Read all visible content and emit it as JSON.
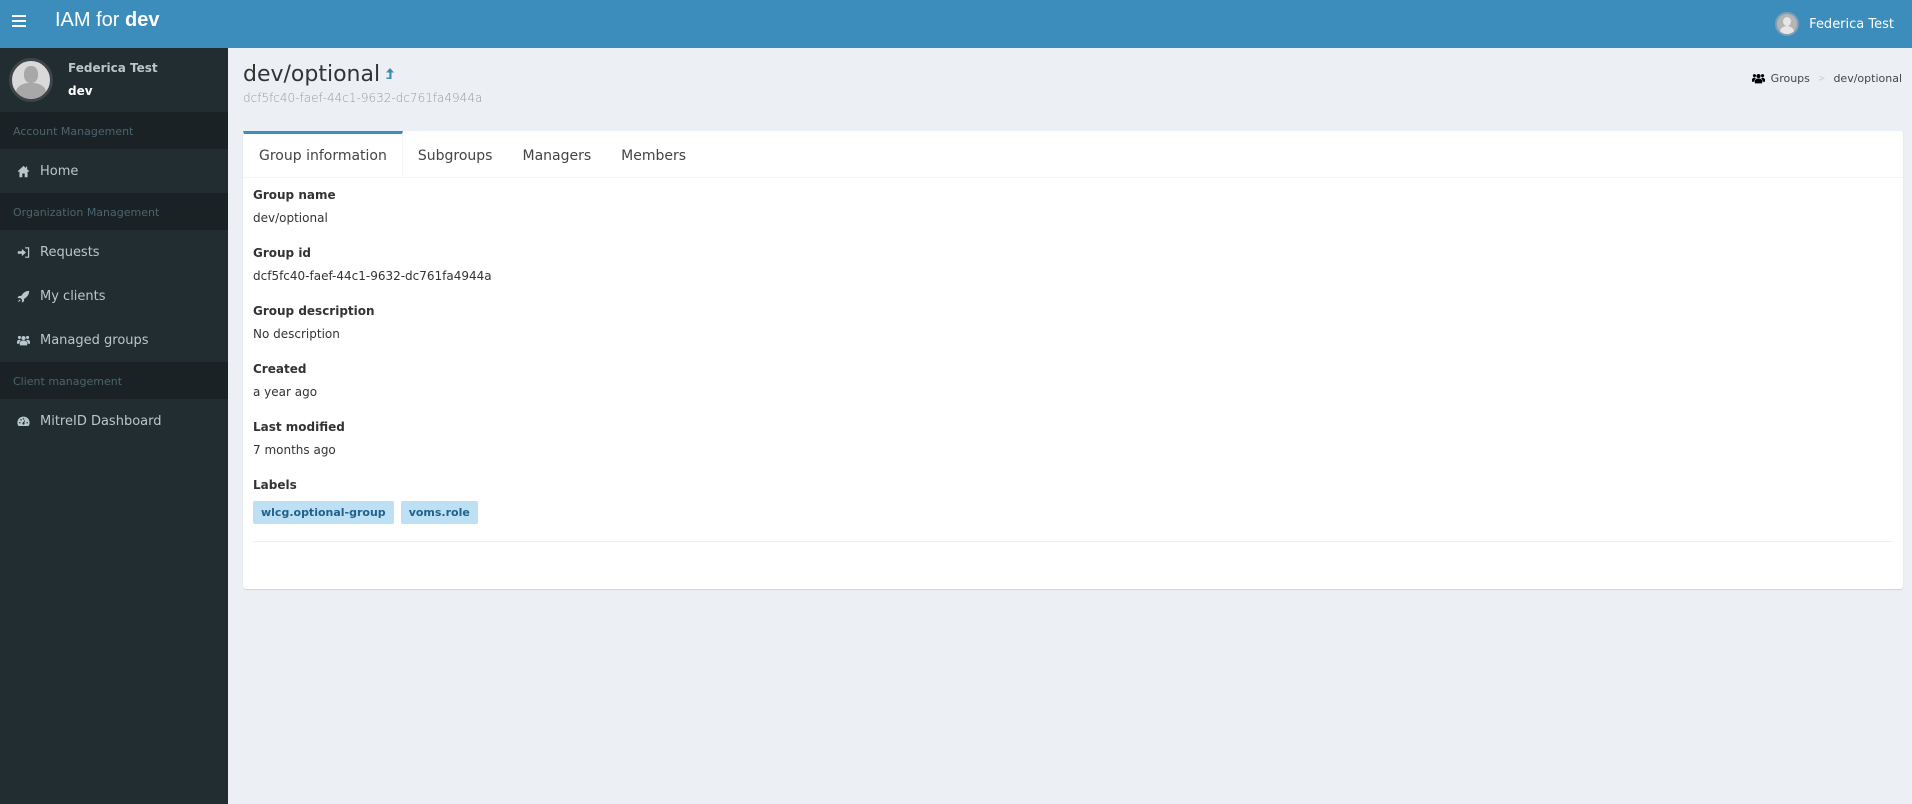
{
  "header": {
    "brand_prefix": "IAM for ",
    "brand_org": "dev",
    "user_name": "Federica Test"
  },
  "sidebar": {
    "user_name": "Federica Test",
    "user_org": "dev",
    "sections": [
      {
        "header": "Account Management",
        "items": [
          {
            "label": "Home",
            "icon": "home-icon"
          }
        ]
      },
      {
        "header": "Organization Management",
        "items": [
          {
            "label": "Requests",
            "icon": "sign-in-icon"
          },
          {
            "label": "My clients",
            "icon": "rocket-icon"
          },
          {
            "label": "Managed groups",
            "icon": "users-icon"
          }
        ]
      },
      {
        "header": "Client management",
        "items": [
          {
            "label": "MitreID Dashboard",
            "icon": "dashboard-icon"
          }
        ]
      }
    ]
  },
  "page": {
    "title": "dev/optional",
    "subtitle": "dcf5fc40-faef-44c1-9632-dc761fa4944a",
    "breadcrumb": [
      "Groups",
      "dev/optional"
    ]
  },
  "tabs": [
    {
      "label": "Group information",
      "active": true
    },
    {
      "label": "Subgroups",
      "active": false
    },
    {
      "label": "Managers",
      "active": false
    },
    {
      "label": "Members",
      "active": false
    }
  ],
  "group_info": {
    "fields": [
      {
        "label": "Group name",
        "value": "dev/optional"
      },
      {
        "label": "Group id",
        "value": "dcf5fc40-faef-44c1-9632-dc761fa4944a"
      },
      {
        "label": "Group description",
        "value": "No description"
      },
      {
        "label": "Created",
        "value": "a year ago"
      },
      {
        "label": "Last modified",
        "value": "7 months ago"
      }
    ],
    "labels_title": "Labels",
    "labels": [
      "wlcg.optional-group",
      "voms.role"
    ]
  },
  "colors": {
    "header_bg": "#3c8dbc",
    "sidebar_bg": "#222d32",
    "content_bg": "#ecf0f5",
    "tag_bg": "#bde0f4",
    "tag_text": "#21618c"
  }
}
